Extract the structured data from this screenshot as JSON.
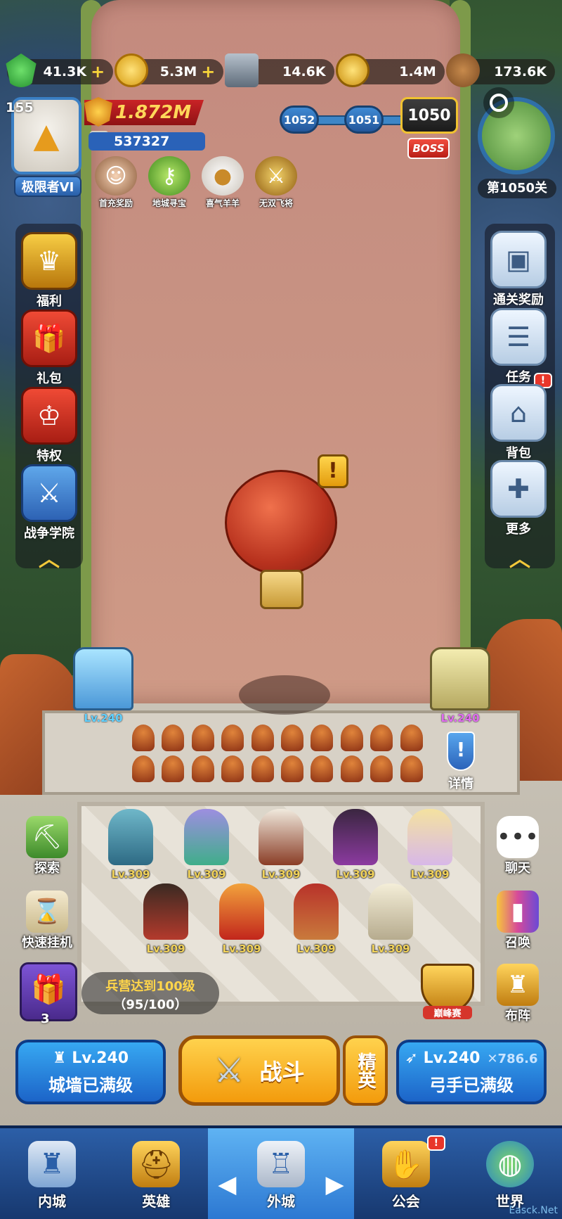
{
  "resources": [
    {
      "icon": "gem-icon",
      "value": "41.3K",
      "plus": "+"
    },
    {
      "icon": "gold-coin-icon",
      "value": "5.3M",
      "plus": "+"
    },
    {
      "icon": "iron-icon",
      "value": "14.6K"
    },
    {
      "icon": "star-medal-icon",
      "value": "1.4M"
    },
    {
      "icon": "wood-log-icon",
      "value": "173.6K"
    }
  ],
  "player": {
    "level": "155",
    "rank": "极限者VI",
    "power": "1.872M",
    "id": "537327"
  },
  "quick_icons": [
    {
      "label": "首充奖励",
      "icon": "girl-portrait-icon"
    },
    {
      "label": "地城寻宝",
      "icon": "treasure-key-icon"
    },
    {
      "label": "喜气羊羊",
      "icon": "sheep-icon"
    },
    {
      "label": "无双飞将",
      "icon": "warrior-icon"
    }
  ],
  "stages": {
    "prev2": "1052",
    "prev1": "1051",
    "current": "1050",
    "boss": "BOSS",
    "label": "第1050关"
  },
  "left_menu": [
    {
      "label": "福利",
      "icon": "crown-shield-icon"
    },
    {
      "label": "礼包",
      "icon": "gift-icon"
    },
    {
      "label": "特权",
      "icon": "crown-icon"
    },
    {
      "label": "战争学院",
      "icon": "crossed-swords-shield-icon"
    }
  ],
  "right_menu": [
    {
      "label": "通关奖励",
      "icon": "reward-box-icon"
    },
    {
      "label": "任务",
      "icon": "task-list-icon",
      "badge": "!"
    },
    {
      "label": "背包",
      "icon": "backpack-icon"
    },
    {
      "label": "更多",
      "icon": "plus-icon"
    }
  ],
  "towers": {
    "left_level": "Lv.240",
    "right_level": "Lv.240",
    "detail_label": "详情"
  },
  "heroes": [
    {
      "level": "Lv.309"
    },
    {
      "level": "Lv.309"
    },
    {
      "level": "Lv.309"
    },
    {
      "level": "Lv.309"
    },
    {
      "level": "Lv.309"
    },
    {
      "level": "Lv.309"
    },
    {
      "level": "Lv.309"
    },
    {
      "level": "Lv.309"
    },
    {
      "level": "Lv.309"
    }
  ],
  "tools": {
    "explore": "探索",
    "afk": "快速挂机",
    "chat": "聊天",
    "summon": "召唤",
    "formation": "布阵",
    "gift_count": "3",
    "barracks_line1": "兵营达到100级",
    "barracks_line2": "（95/100）",
    "peak_label": "巅峰赛"
  },
  "actions": {
    "wall_level": "Lv.240",
    "wall_state": "城墙已满级",
    "battle": "战斗",
    "elite": "精英",
    "archer_level": "Lv.240",
    "archer_power": "786.6",
    "archer_state": "弓手已满级"
  },
  "tabs": [
    {
      "label": "内城",
      "icon": "castle-icon"
    },
    {
      "label": "英雄",
      "icon": "helmet-icon"
    },
    {
      "label": "外城",
      "icon": "outer-castle-icon",
      "active": true
    },
    {
      "label": "公会",
      "icon": "handshake-icon",
      "badge": "!"
    },
    {
      "label": "世界",
      "icon": "globe-icon"
    }
  ],
  "watermark": "Easck.Net"
}
